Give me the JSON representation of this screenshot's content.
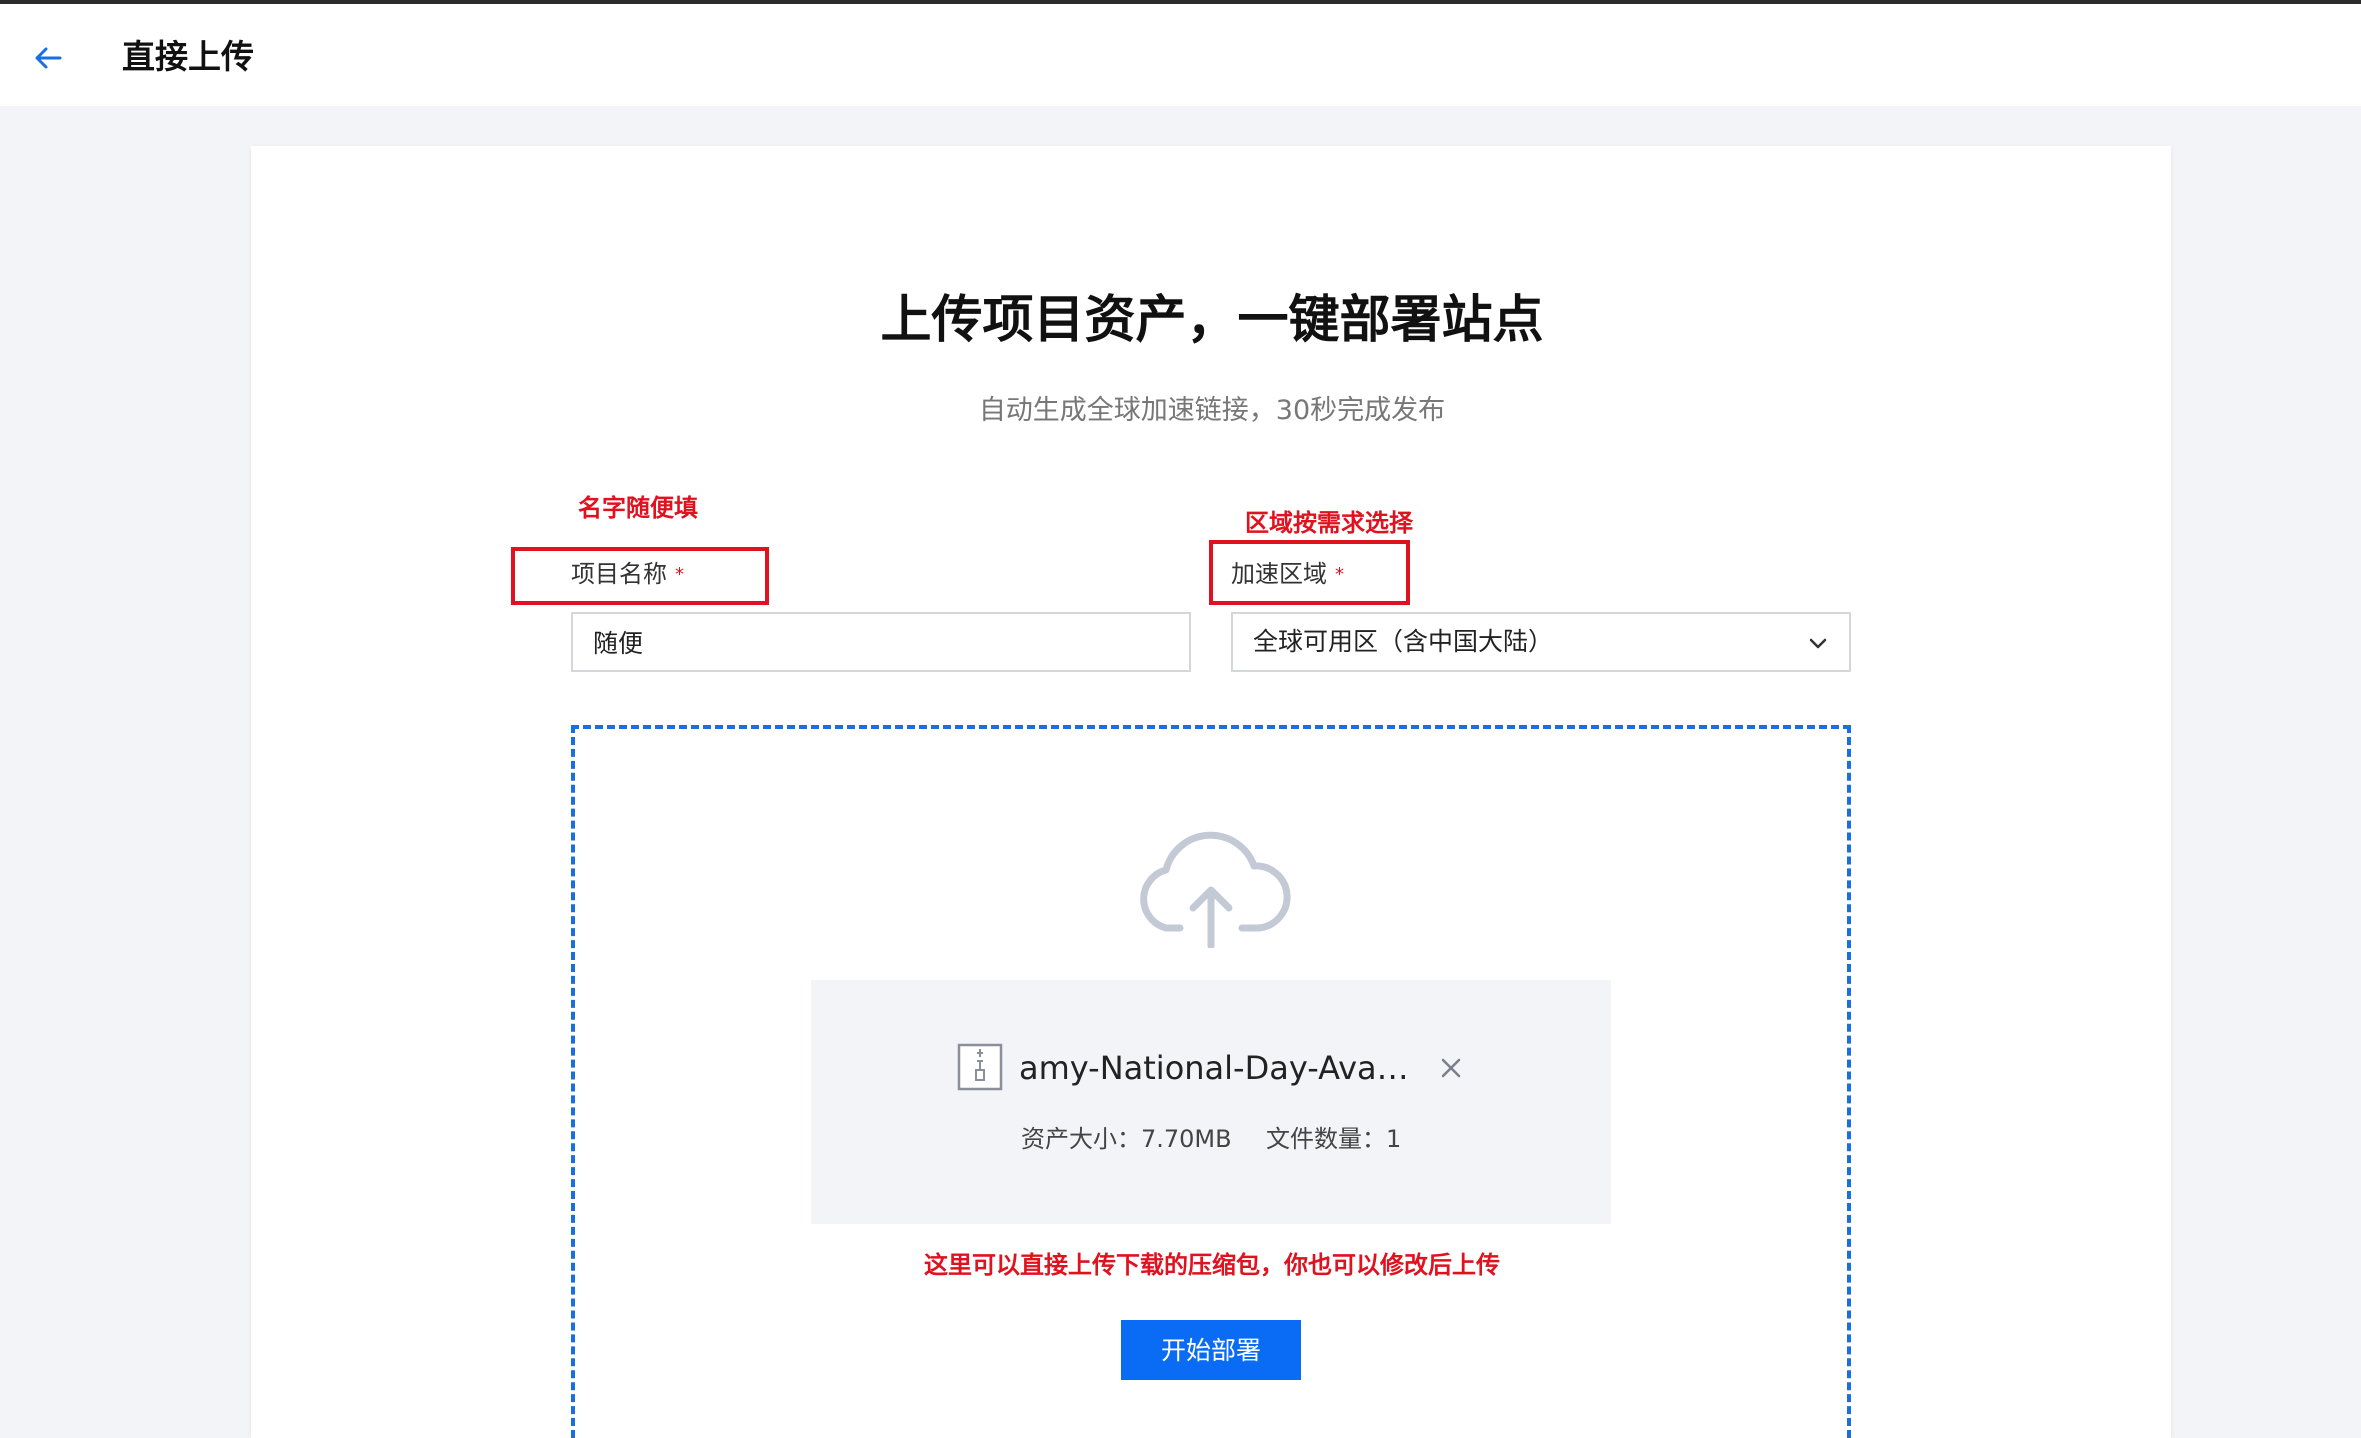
{
  "header": {
    "title": "直接上传"
  },
  "main": {
    "title": "上传项目资产，一键部署站点",
    "subtitle": "自动生成全球加速链接，30秒完成发布"
  },
  "form": {
    "project_name": {
      "label": "项目名称",
      "required_mark": "*",
      "value": "随便"
    },
    "region": {
      "label": "加速区域",
      "required_mark": "*",
      "selected": "全球可用区（含中国大陆）"
    }
  },
  "upload": {
    "file_name": "amy-National-Day-Avatar…",
    "size_label": "资产大小：7.70MB",
    "count_label": "文件数量：1"
  },
  "deploy_button": "开始部署",
  "annotations": {
    "name_hint": "名字随便填",
    "region_hint": "区域按需求选择",
    "upload_hint": "这里可以直接上传下载的压缩包，你也可以修改后上传"
  },
  "colors": {
    "accent": "#0a6cf5",
    "annotation": "#e0121f",
    "dropzone_border": "#1a6fe0"
  },
  "icons": [
    "back-arrow-icon",
    "chevron-down-icon",
    "cloud-upload-icon",
    "zip-file-icon",
    "close-icon"
  ]
}
